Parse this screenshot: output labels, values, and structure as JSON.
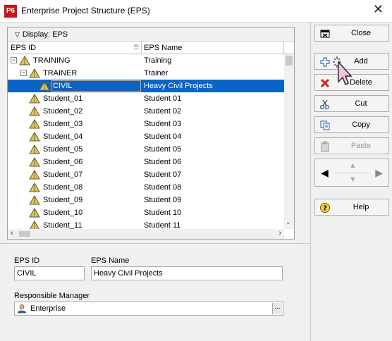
{
  "window": {
    "app_icon": "P6",
    "title": "Enterprise Project Structure (EPS)",
    "close_glyph": "✕"
  },
  "grid": {
    "display_label": "Display: EPS",
    "columns": [
      "EPS ID",
      "EPS Name"
    ],
    "rows": [
      {
        "id": "TRAINING",
        "name": "Training",
        "expander": "−"
      },
      {
        "id": "TRAINER",
        "name": "Trainer",
        "expander": "−"
      },
      {
        "id": "CIVIL",
        "name": "Heavy Civil Projects",
        "selected": true
      },
      {
        "id": "Student_01",
        "name": "Student 01"
      },
      {
        "id": "Student_02",
        "name": "Student 02"
      },
      {
        "id": "Student_03",
        "name": "Student 03"
      },
      {
        "id": "Student_04",
        "name": "Student 04"
      },
      {
        "id": "Student_05",
        "name": "Student 05"
      },
      {
        "id": "Student_06",
        "name": "Student 06"
      },
      {
        "id": "Student_07",
        "name": "Student 07"
      },
      {
        "id": "Student_08",
        "name": "Student 08"
      },
      {
        "id": "Student_09",
        "name": "Student 09"
      },
      {
        "id": "Student_10",
        "name": "Student 10"
      },
      {
        "id": "Student_11",
        "name": "Student 11"
      }
    ]
  },
  "details": {
    "eps_id_label": "EPS ID",
    "eps_id_value": "CIVIL",
    "eps_name_label": "EPS Name",
    "eps_name_value": "Heavy Civil Projects",
    "manager_label": "Responsible Manager",
    "manager_value": "Enterprise",
    "browse": "..."
  },
  "buttons": {
    "close": "Close",
    "add": "Add",
    "delete": "Delete",
    "cut": "Cut",
    "copy": "Copy",
    "paste": "Paste",
    "help": "Help"
  },
  "colors": {
    "selection": "#0a64c8",
    "brand": "#c4161c"
  }
}
